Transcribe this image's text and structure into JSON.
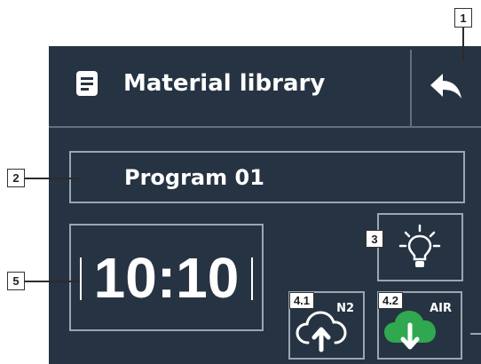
{
  "header": {
    "title": "Material library",
    "icon": "document-icon",
    "back_icon": "reply-arrow-icon"
  },
  "program": {
    "name": "Program 01"
  },
  "clock": {
    "time": "10:10"
  },
  "buttons": {
    "light": {
      "icon": "lightbulb-icon"
    },
    "n2": {
      "label": "N2",
      "icon": "cloud-upload-icon"
    },
    "air": {
      "label": "AIR",
      "icon": "cloud-download-icon",
      "accent": "#2fa84f"
    }
  },
  "callouts": {
    "c1": "1",
    "c2": "2",
    "c3": "3",
    "c41": "4.1",
    "c42": "4.2",
    "c5": "5"
  },
  "colors": {
    "background": "#263342",
    "border": "#9aa6b1",
    "divider": "#61707f",
    "text": "#ffffff"
  }
}
